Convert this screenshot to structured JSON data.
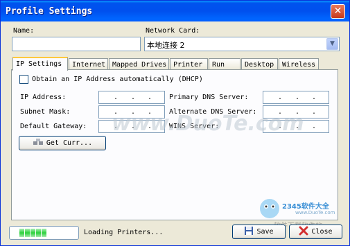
{
  "window": {
    "title": "Profile Settings"
  },
  "name_field": {
    "label": "Name:",
    "value": ""
  },
  "network_card": {
    "label": "Network Card:",
    "value": "本地连接 2"
  },
  "tabs": [
    {
      "label": "IP Settings",
      "active": true
    },
    {
      "label": "Internet"
    },
    {
      "label": "Mapped Drives"
    },
    {
      "label": "Printer"
    },
    {
      "label": "Run"
    },
    {
      "label": "Desktop"
    },
    {
      "label": "Wireless"
    }
  ],
  "ip_settings": {
    "dhcp_label": "Obtain an IP Address automatically (DHCP)",
    "dhcp_checked": false,
    "ip_address_label": "IP Address:",
    "subnet_mask_label": "Subnet Mask:",
    "default_gateway_label": "Default Gateway:",
    "primary_dns_label": "Primary DNS Server:",
    "alternate_dns_label": "Alternate DNS Server:",
    "wins_label": "WINS Server:",
    "get_current_label": "Get Curr..."
  },
  "status": {
    "text": "Loading Printers...",
    "progress_segments": 5
  },
  "buttons": {
    "save": "Save",
    "close": "Close"
  },
  "watermark": {
    "text": "www.DuoTe.com",
    "logo_text": "2345软件大全",
    "logo_url": "www.DuoTe.com",
    "logo_bottom": "软件下载软件站"
  },
  "colors": {
    "titlebar": "#0053ee",
    "face": "#ece9d8",
    "tab_highlight": "#ffc83c",
    "progress": "#2cd13c"
  }
}
